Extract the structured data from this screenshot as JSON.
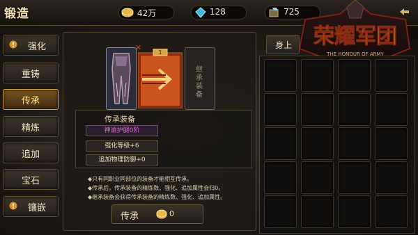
{
  "header": {
    "title": "锻造",
    "gold": "42万",
    "crystal": "128",
    "gem": "725"
  },
  "logo": {
    "title": "荣耀军团",
    "subtitle": "THE HONOUR OF ARMY"
  },
  "nav": {
    "items": [
      {
        "label": "强化",
        "icon": "exclamation-icon"
      },
      {
        "label": "重铸",
        "icon": ""
      },
      {
        "label": "传承",
        "icon": "",
        "active": true
      },
      {
        "label": "精炼",
        "icon": ""
      },
      {
        "label": "追加",
        "icon": ""
      },
      {
        "label": "宝石",
        "icon": ""
      },
      {
        "label": "镶嵌",
        "icon": "exclamation-icon"
      }
    ]
  },
  "forge": {
    "target_slot_label": "继承装备",
    "info_title": "传承装备",
    "item_name": "神谕护腿0阶",
    "enhance_level": "强化等级+6",
    "extra_defense": "追加物理防御+0",
    "notes": [
      "◆只有同职业同部位的装备才能相互传承。",
      "◆传承后，传承装备的精炼数、强化、追加属性会归0。",
      "◆继承装备会获得传承装备的精炼数、强化、追加属性。"
    ],
    "button_label": "传承",
    "cost": "0",
    "arrow_badge": "1"
  },
  "inventory": {
    "tab_label": "身上",
    "rows": 5,
    "cols": 4
  },
  "colors": {
    "accent_gold": "#d8a64a",
    "highlight_purple": "#d86ad8",
    "warning_red": "#e03a2c"
  }
}
